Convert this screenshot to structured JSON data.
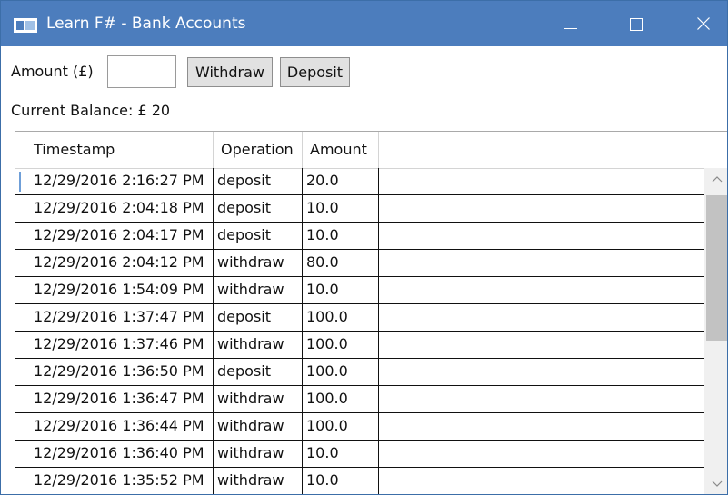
{
  "window": {
    "title": "Learn F# - Bank Accounts",
    "title_bar_color": "#4c7dbd"
  },
  "form": {
    "amount_label": "Amount (£)",
    "amount_value": "",
    "withdraw_label": "Withdraw",
    "deposit_label": "Deposit",
    "balance_label": "Current Balance: £  20"
  },
  "grid": {
    "columns": [
      "Timestamp",
      "Operation",
      "Amount"
    ],
    "rows": [
      {
        "timestamp": "12/29/2016 2:16:27 PM",
        "operation": "deposit",
        "amount": "20.0"
      },
      {
        "timestamp": "12/29/2016 2:04:18 PM",
        "operation": "deposit",
        "amount": "10.0"
      },
      {
        "timestamp": "12/29/2016 2:04:17 PM",
        "operation": "deposit",
        "amount": "10.0"
      },
      {
        "timestamp": "12/29/2016 2:04:12 PM",
        "operation": "withdraw",
        "amount": "80.0"
      },
      {
        "timestamp": "12/29/2016 1:54:09 PM",
        "operation": "withdraw",
        "amount": "10.0"
      },
      {
        "timestamp": "12/29/2016 1:37:47 PM",
        "operation": "deposit",
        "amount": "100.0"
      },
      {
        "timestamp": "12/29/2016 1:37:46 PM",
        "operation": "withdraw",
        "amount": "100.0"
      },
      {
        "timestamp": "12/29/2016 1:36:50 PM",
        "operation": "deposit",
        "amount": "100.0"
      },
      {
        "timestamp": "12/29/2016 1:36:47 PM",
        "operation": "withdraw",
        "amount": "100.0"
      },
      {
        "timestamp": "12/29/2016 1:36:44 PM",
        "operation": "withdraw",
        "amount": "100.0"
      },
      {
        "timestamp": "12/29/2016 1:36:40 PM",
        "operation": "withdraw",
        "amount": "10.0"
      },
      {
        "timestamp": "12/29/2016 1:35:52 PM",
        "operation": "withdraw",
        "amount": "10.0"
      }
    ],
    "selected_row_marker_color": "#6f9fd8"
  },
  "icons": {
    "app": "window-app-icon",
    "minimize": "minimize-icon",
    "maximize": "maximize-icon",
    "close": "close-icon",
    "scroll_up": "chevron-up-icon",
    "scroll_down": "chevron-down-icon"
  }
}
